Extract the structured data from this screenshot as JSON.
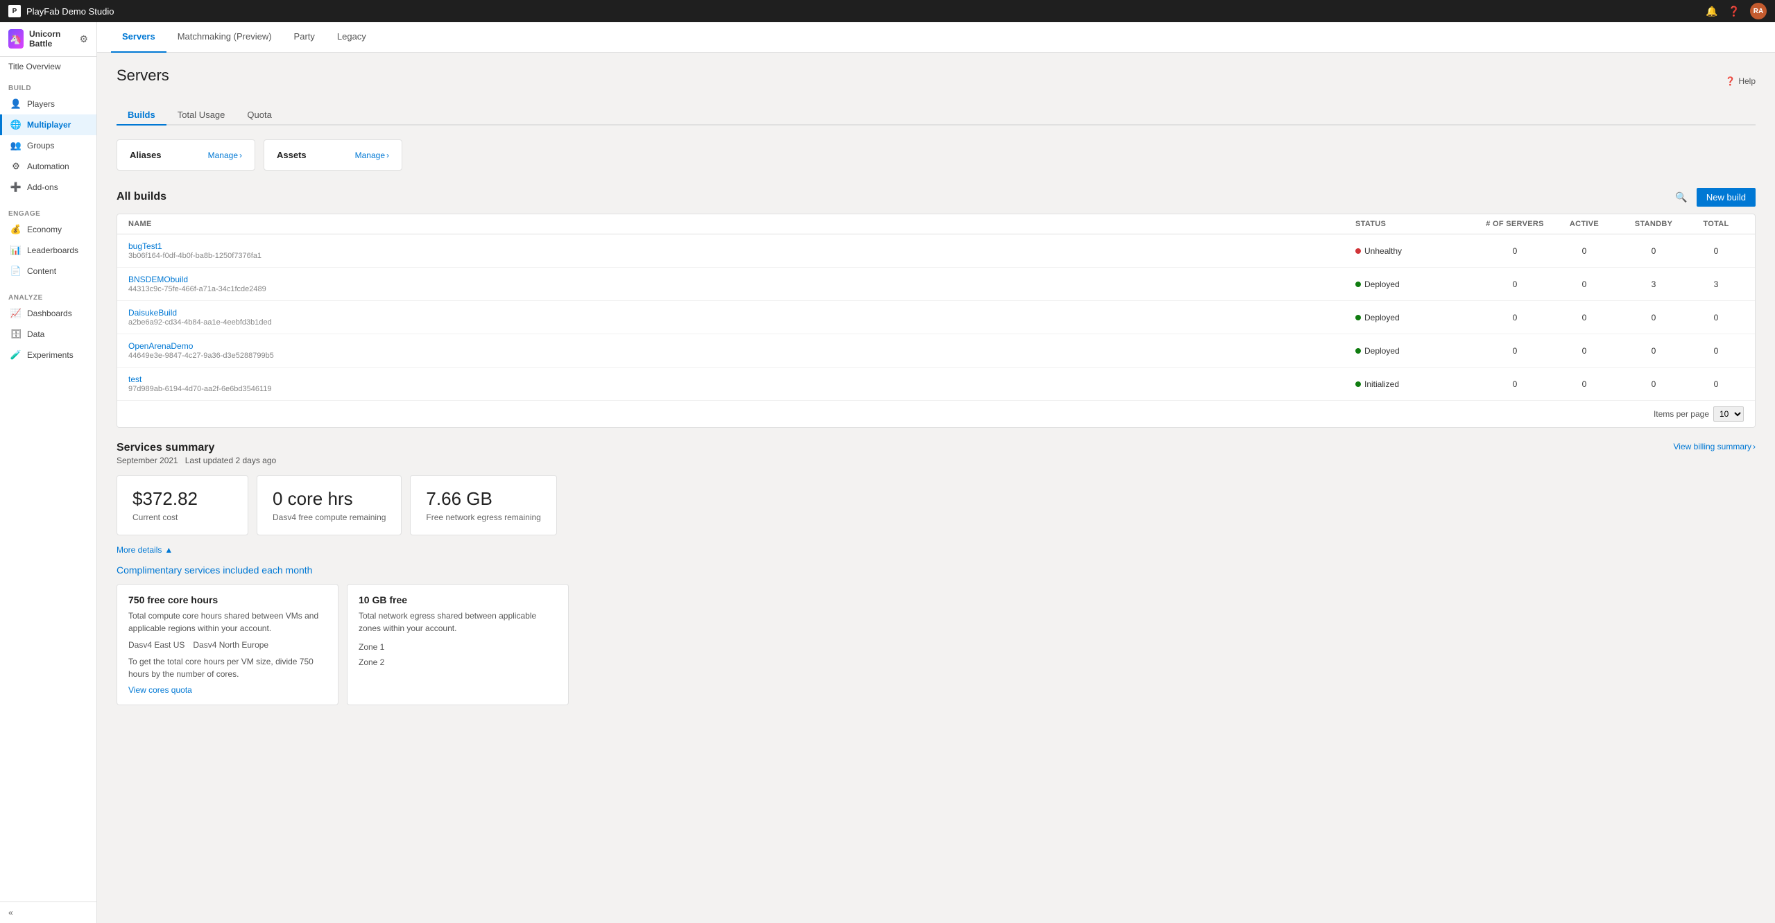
{
  "topbar": {
    "studio_name": "PlayFab Demo Studio",
    "icons": [
      "bell",
      "question",
      "avatar"
    ],
    "avatar_initials": "RA"
  },
  "sidebar": {
    "brand_name": "Unicorn Battle",
    "title_overview": "Title Overview",
    "sections": [
      {
        "label": "BUILD",
        "items": [
          {
            "id": "players",
            "label": "Players",
            "icon": "👤",
            "active": false
          },
          {
            "id": "multiplayer",
            "label": "Multiplayer",
            "icon": "🌐",
            "active": true
          },
          {
            "id": "groups",
            "label": "Groups",
            "icon": "👥",
            "active": false
          },
          {
            "id": "automation",
            "label": "Automation",
            "icon": "⚙",
            "active": false
          },
          {
            "id": "add-ons",
            "label": "Add-ons",
            "icon": "➕",
            "active": false
          }
        ]
      },
      {
        "label": "ENGAGE",
        "items": [
          {
            "id": "economy",
            "label": "Economy",
            "icon": "💰",
            "active": false
          },
          {
            "id": "leaderboards",
            "label": "Leaderboards",
            "icon": "📊",
            "active": false
          },
          {
            "id": "content",
            "label": "Content",
            "icon": "📄",
            "active": false
          }
        ]
      },
      {
        "label": "ANALYZE",
        "items": [
          {
            "id": "dashboards",
            "label": "Dashboards",
            "icon": "📈",
            "active": false
          },
          {
            "id": "data",
            "label": "Data",
            "icon": "🗄",
            "active": false
          },
          {
            "id": "experiments",
            "label": "Experiments",
            "icon": "🧪",
            "active": false
          }
        ]
      }
    ],
    "collapse_label": "Collapse"
  },
  "tabs": [
    {
      "id": "servers",
      "label": "Servers",
      "active": true
    },
    {
      "id": "matchmaking",
      "label": "Matchmaking (Preview)",
      "active": false
    },
    {
      "id": "party",
      "label": "Party",
      "active": false
    },
    {
      "id": "legacy",
      "label": "Legacy",
      "active": false
    }
  ],
  "page": {
    "title": "Servers",
    "sub_tabs": [
      {
        "id": "builds",
        "label": "Builds",
        "active": true
      },
      {
        "id": "total-usage",
        "label": "Total Usage",
        "active": false
      },
      {
        "id": "quota",
        "label": "Quota",
        "active": false
      }
    ],
    "help_label": "Help",
    "aliases": {
      "title": "Aliases",
      "manage_label": "Manage",
      "manage_arrow": "›"
    },
    "assets": {
      "title": "Assets",
      "manage_label": "Manage",
      "manage_arrow": "›"
    },
    "all_builds": {
      "title": "All builds",
      "new_build_label": "New build",
      "table": {
        "headers": [
          "Name",
          "Status",
          "# of servers",
          "Active",
          "Standby",
          "Total"
        ],
        "rows": [
          {
            "name": "bugTest1",
            "id": "3b06f164-f0df-4b0f-ba8b-1250f7376fa1",
            "status": "Unhealthy",
            "status_type": "unhealthy",
            "active": "0",
            "standby": "0",
            "total": "0"
          },
          {
            "name": "BNSDEMObuild",
            "id": "44313c9c-75fe-466f-a71a-34c1fcde2489",
            "status": "Deployed",
            "status_type": "deployed",
            "active": "0",
            "standby": "3",
            "total": "3"
          },
          {
            "name": "DaisukeBuild",
            "id": "a2be6a92-cd34-4b84-aa1e-4eebfd3b1ded",
            "status": "Deployed",
            "status_type": "deployed",
            "active": "0",
            "standby": "0",
            "total": "0"
          },
          {
            "name": "OpenArenaDemo",
            "id": "44649e3e-9847-4c27-9a36-d3e5288799b5",
            "status": "Deployed",
            "status_type": "deployed",
            "active": "0",
            "standby": "0",
            "total": "0"
          },
          {
            "name": "test",
            "id": "97d989ab-6194-4d70-aa2f-6e6bd3546119",
            "status": "Initialized",
            "status_type": "initialized",
            "active": "0",
            "standby": "0",
            "total": "0"
          }
        ],
        "items_per_page_label": "Items per page",
        "items_per_page_value": "10"
      }
    },
    "services_summary": {
      "title": "Services summary",
      "date": "September 2021",
      "last_updated": "Last updated 2 days ago",
      "view_billing_label": "View billing summary",
      "metrics": [
        {
          "value": "$372.82",
          "label": "Current cost"
        },
        {
          "value": "0 core hrs",
          "label": "Dasv4 free compute remaining"
        },
        {
          "value": "7.66 GB",
          "label": "Free network egress remaining"
        }
      ],
      "more_details_label": "More details",
      "complimentary_title": "Complimentary services included each month",
      "comp_cards": [
        {
          "title": "750 free core hours",
          "text": "Total compute core hours shared between VMs and applicable regions within your account.",
          "regions": [
            "Dasv4 East US",
            "Dasv4 North Europe"
          ],
          "note": "To get the total core hours per VM size, divide 750 hours by the number of cores.",
          "link": "View cores quota"
        },
        {
          "title": "10 GB free",
          "text": "Total network egress shared between applicable zones within your account.",
          "zones": [
            "Zone 1",
            "Zone 2"
          ]
        }
      ]
    }
  }
}
